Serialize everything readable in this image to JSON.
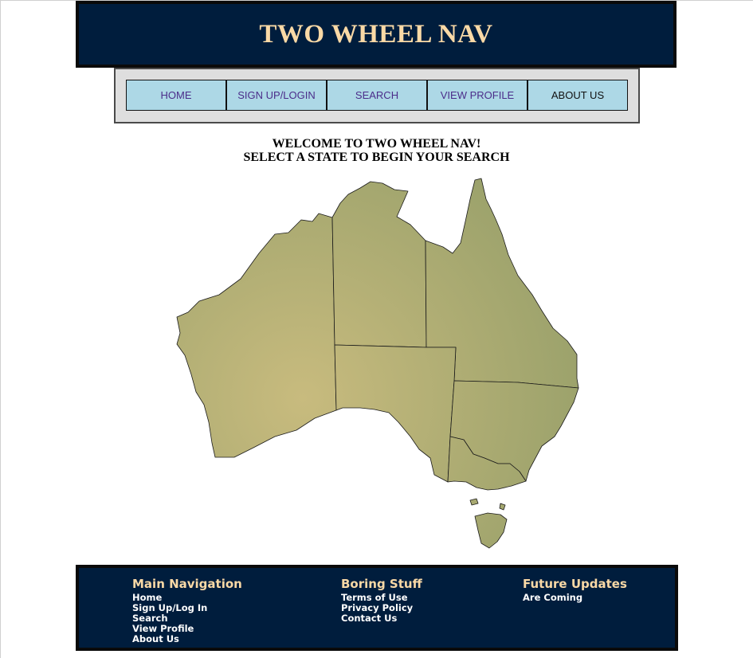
{
  "header": {
    "title": "TWO WHEEL NAV"
  },
  "nav": {
    "items": [
      {
        "label": "HOME"
      },
      {
        "label": "SIGN UP/LOGIN"
      },
      {
        "label": "SEARCH"
      },
      {
        "label": "VIEW PROFILE"
      },
      {
        "label": "ABOUT US"
      }
    ]
  },
  "main": {
    "welcome_line1": "WELCOME TO TWO WHEEL NAV!",
    "welcome_line2": "SELECT A STATE TO BEGIN YOUR SEARCH"
  },
  "map": {
    "fill_light": "#c8bb7e",
    "fill_dark": "#98a06a",
    "border_color": "#1a1a1a"
  },
  "footer": {
    "col1": {
      "heading": "Main Navigation",
      "links": [
        "Home",
        "Sign Up/Log In",
        "Search",
        "View Profile",
        "About Us"
      ]
    },
    "col2": {
      "heading": "Boring Stuff",
      "links": [
        "Terms of Use",
        "Privacy Policy",
        "Contact Us"
      ]
    },
    "col3": {
      "heading": "Future Updates",
      "links": [
        "Are Coming"
      ]
    }
  },
  "colors": {
    "navy": "#001d3d",
    "gold_text": "#fad9a6",
    "nav_bg": "#add8e6",
    "nav_text": "#4b2d8a"
  }
}
